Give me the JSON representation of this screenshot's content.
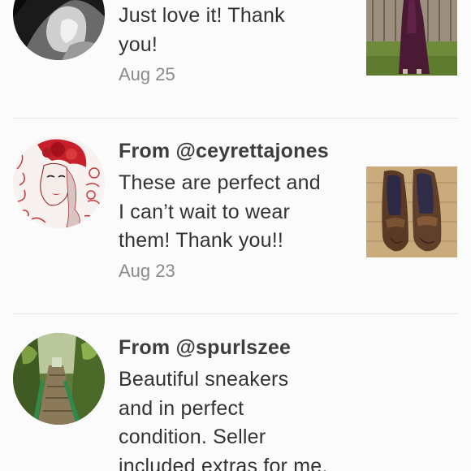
{
  "reviews": [
    {
      "from": "",
      "text": "Just love it! Thank you!",
      "text_lines": [
        "Just love it! Thank",
        "you!"
      ],
      "date": "Aug 25",
      "avatar_icon": "bw-portrait-avatar-icon",
      "thumb_icon": "purple-dress-photo"
    },
    {
      "from": "From @ceyrettajones",
      "text": "These are perfect and I can’t wait to wear them! Thank you!!",
      "text_lines": [
        "These are perfect and",
        "I can’t wait to wear",
        "them! Thank you!!"
      ],
      "date": "Aug 23",
      "avatar_icon": "red-floral-woman-avatar-icon",
      "thumb_icon": "brown-loafers-photo"
    },
    {
      "from": "From @spurlszee",
      "text": "Beautiful sneakers and in perfect condition. Seller included extras for me.",
      "text_lines": [
        "Beautiful sneakers",
        "and in perfect",
        "condition. Seller",
        "included extras for me."
      ],
      "date": "",
      "avatar_icon": "forest-path-avatar-icon",
      "thumb_icon": ""
    }
  ],
  "colors": {
    "background": "#fbfbfb",
    "text": "#333333",
    "date": "#8a8a8a",
    "divider": "#e4e4e4"
  }
}
